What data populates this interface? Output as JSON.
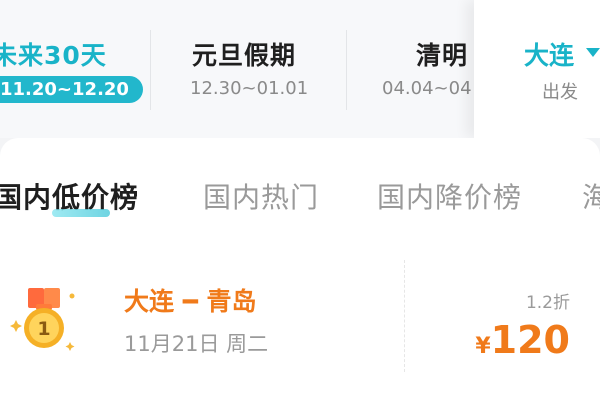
{
  "date_tabs": [
    {
      "name": "未来30天",
      "range": "11.20~12.20",
      "selected": true
    },
    {
      "name": "元旦假期",
      "range": "12.30~01.01"
    },
    {
      "name": "清明",
      "range": "04.04~04"
    }
  ],
  "departure": {
    "city": "大连",
    "label": "出发"
  },
  "category_tabs": [
    "国内低价榜",
    "国内热门",
    "国内降价榜",
    "海"
  ],
  "deal": {
    "rank": "1",
    "route": "大连 ━ 青岛",
    "date": "11月21日 周二",
    "discount": "1.2折",
    "currency": "¥",
    "price": "120"
  },
  "colors": {
    "accent": "#19b3c8",
    "price": "#f07a1a"
  }
}
